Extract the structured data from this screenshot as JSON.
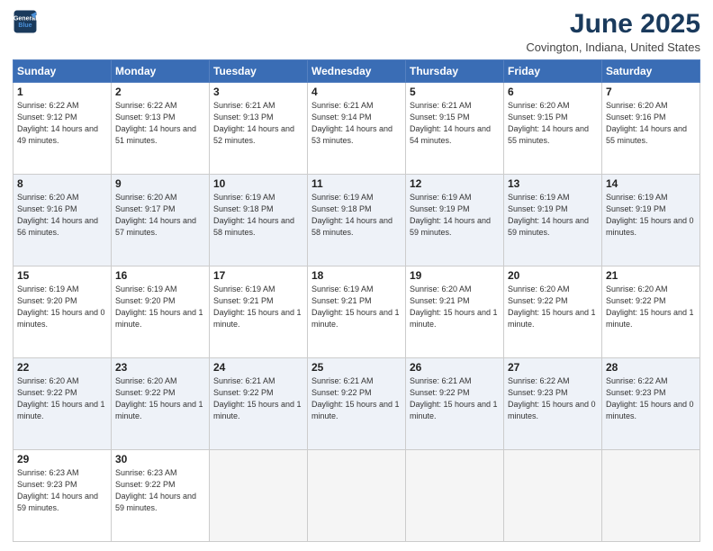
{
  "header": {
    "logo_line1": "General",
    "logo_line2": "Blue",
    "title": "June 2025",
    "subtitle": "Covington, Indiana, United States"
  },
  "days_of_week": [
    "Sunday",
    "Monday",
    "Tuesday",
    "Wednesday",
    "Thursday",
    "Friday",
    "Saturday"
  ],
  "weeks": [
    [
      {
        "day": "1",
        "sunrise": "6:22 AM",
        "sunset": "9:12 PM",
        "daylight": "14 hours and 49 minutes."
      },
      {
        "day": "2",
        "sunrise": "6:22 AM",
        "sunset": "9:13 PM",
        "daylight": "14 hours and 51 minutes."
      },
      {
        "day": "3",
        "sunrise": "6:21 AM",
        "sunset": "9:13 PM",
        "daylight": "14 hours and 52 minutes."
      },
      {
        "day": "4",
        "sunrise": "6:21 AM",
        "sunset": "9:14 PM",
        "daylight": "14 hours and 53 minutes."
      },
      {
        "day": "5",
        "sunrise": "6:21 AM",
        "sunset": "9:15 PM",
        "daylight": "14 hours and 54 minutes."
      },
      {
        "day": "6",
        "sunrise": "6:20 AM",
        "sunset": "9:15 PM",
        "daylight": "14 hours and 55 minutes."
      },
      {
        "day": "7",
        "sunrise": "6:20 AM",
        "sunset": "9:16 PM",
        "daylight": "14 hours and 55 minutes."
      }
    ],
    [
      {
        "day": "8",
        "sunrise": "6:20 AM",
        "sunset": "9:16 PM",
        "daylight": "14 hours and 56 minutes."
      },
      {
        "day": "9",
        "sunrise": "6:20 AM",
        "sunset": "9:17 PM",
        "daylight": "14 hours and 57 minutes."
      },
      {
        "day": "10",
        "sunrise": "6:19 AM",
        "sunset": "9:18 PM",
        "daylight": "14 hours and 58 minutes."
      },
      {
        "day": "11",
        "sunrise": "6:19 AM",
        "sunset": "9:18 PM",
        "daylight": "14 hours and 58 minutes."
      },
      {
        "day": "12",
        "sunrise": "6:19 AM",
        "sunset": "9:19 PM",
        "daylight": "14 hours and 59 minutes."
      },
      {
        "day": "13",
        "sunrise": "6:19 AM",
        "sunset": "9:19 PM",
        "daylight": "14 hours and 59 minutes."
      },
      {
        "day": "14",
        "sunrise": "6:19 AM",
        "sunset": "9:19 PM",
        "daylight": "15 hours and 0 minutes."
      }
    ],
    [
      {
        "day": "15",
        "sunrise": "6:19 AM",
        "sunset": "9:20 PM",
        "daylight": "15 hours and 0 minutes."
      },
      {
        "day": "16",
        "sunrise": "6:19 AM",
        "sunset": "9:20 PM",
        "daylight": "15 hours and 1 minute."
      },
      {
        "day": "17",
        "sunrise": "6:19 AM",
        "sunset": "9:21 PM",
        "daylight": "15 hours and 1 minute."
      },
      {
        "day": "18",
        "sunrise": "6:19 AM",
        "sunset": "9:21 PM",
        "daylight": "15 hours and 1 minute."
      },
      {
        "day": "19",
        "sunrise": "6:20 AM",
        "sunset": "9:21 PM",
        "daylight": "15 hours and 1 minute."
      },
      {
        "day": "20",
        "sunrise": "6:20 AM",
        "sunset": "9:22 PM",
        "daylight": "15 hours and 1 minute."
      },
      {
        "day": "21",
        "sunrise": "6:20 AM",
        "sunset": "9:22 PM",
        "daylight": "15 hours and 1 minute."
      }
    ],
    [
      {
        "day": "22",
        "sunrise": "6:20 AM",
        "sunset": "9:22 PM",
        "daylight": "15 hours and 1 minute."
      },
      {
        "day": "23",
        "sunrise": "6:20 AM",
        "sunset": "9:22 PM",
        "daylight": "15 hours and 1 minute."
      },
      {
        "day": "24",
        "sunrise": "6:21 AM",
        "sunset": "9:22 PM",
        "daylight": "15 hours and 1 minute."
      },
      {
        "day": "25",
        "sunrise": "6:21 AM",
        "sunset": "9:22 PM",
        "daylight": "15 hours and 1 minute."
      },
      {
        "day": "26",
        "sunrise": "6:21 AM",
        "sunset": "9:22 PM",
        "daylight": "15 hours and 1 minute."
      },
      {
        "day": "27",
        "sunrise": "6:22 AM",
        "sunset": "9:23 PM",
        "daylight": "15 hours and 0 minutes."
      },
      {
        "day": "28",
        "sunrise": "6:22 AM",
        "sunset": "9:23 PM",
        "daylight": "15 hours and 0 minutes."
      }
    ],
    [
      {
        "day": "29",
        "sunrise": "6:23 AM",
        "sunset": "9:23 PM",
        "daylight": "14 hours and 59 minutes."
      },
      {
        "day": "30",
        "sunrise": "6:23 AM",
        "sunset": "9:22 PM",
        "daylight": "14 hours and 59 minutes."
      },
      null,
      null,
      null,
      null,
      null
    ]
  ]
}
